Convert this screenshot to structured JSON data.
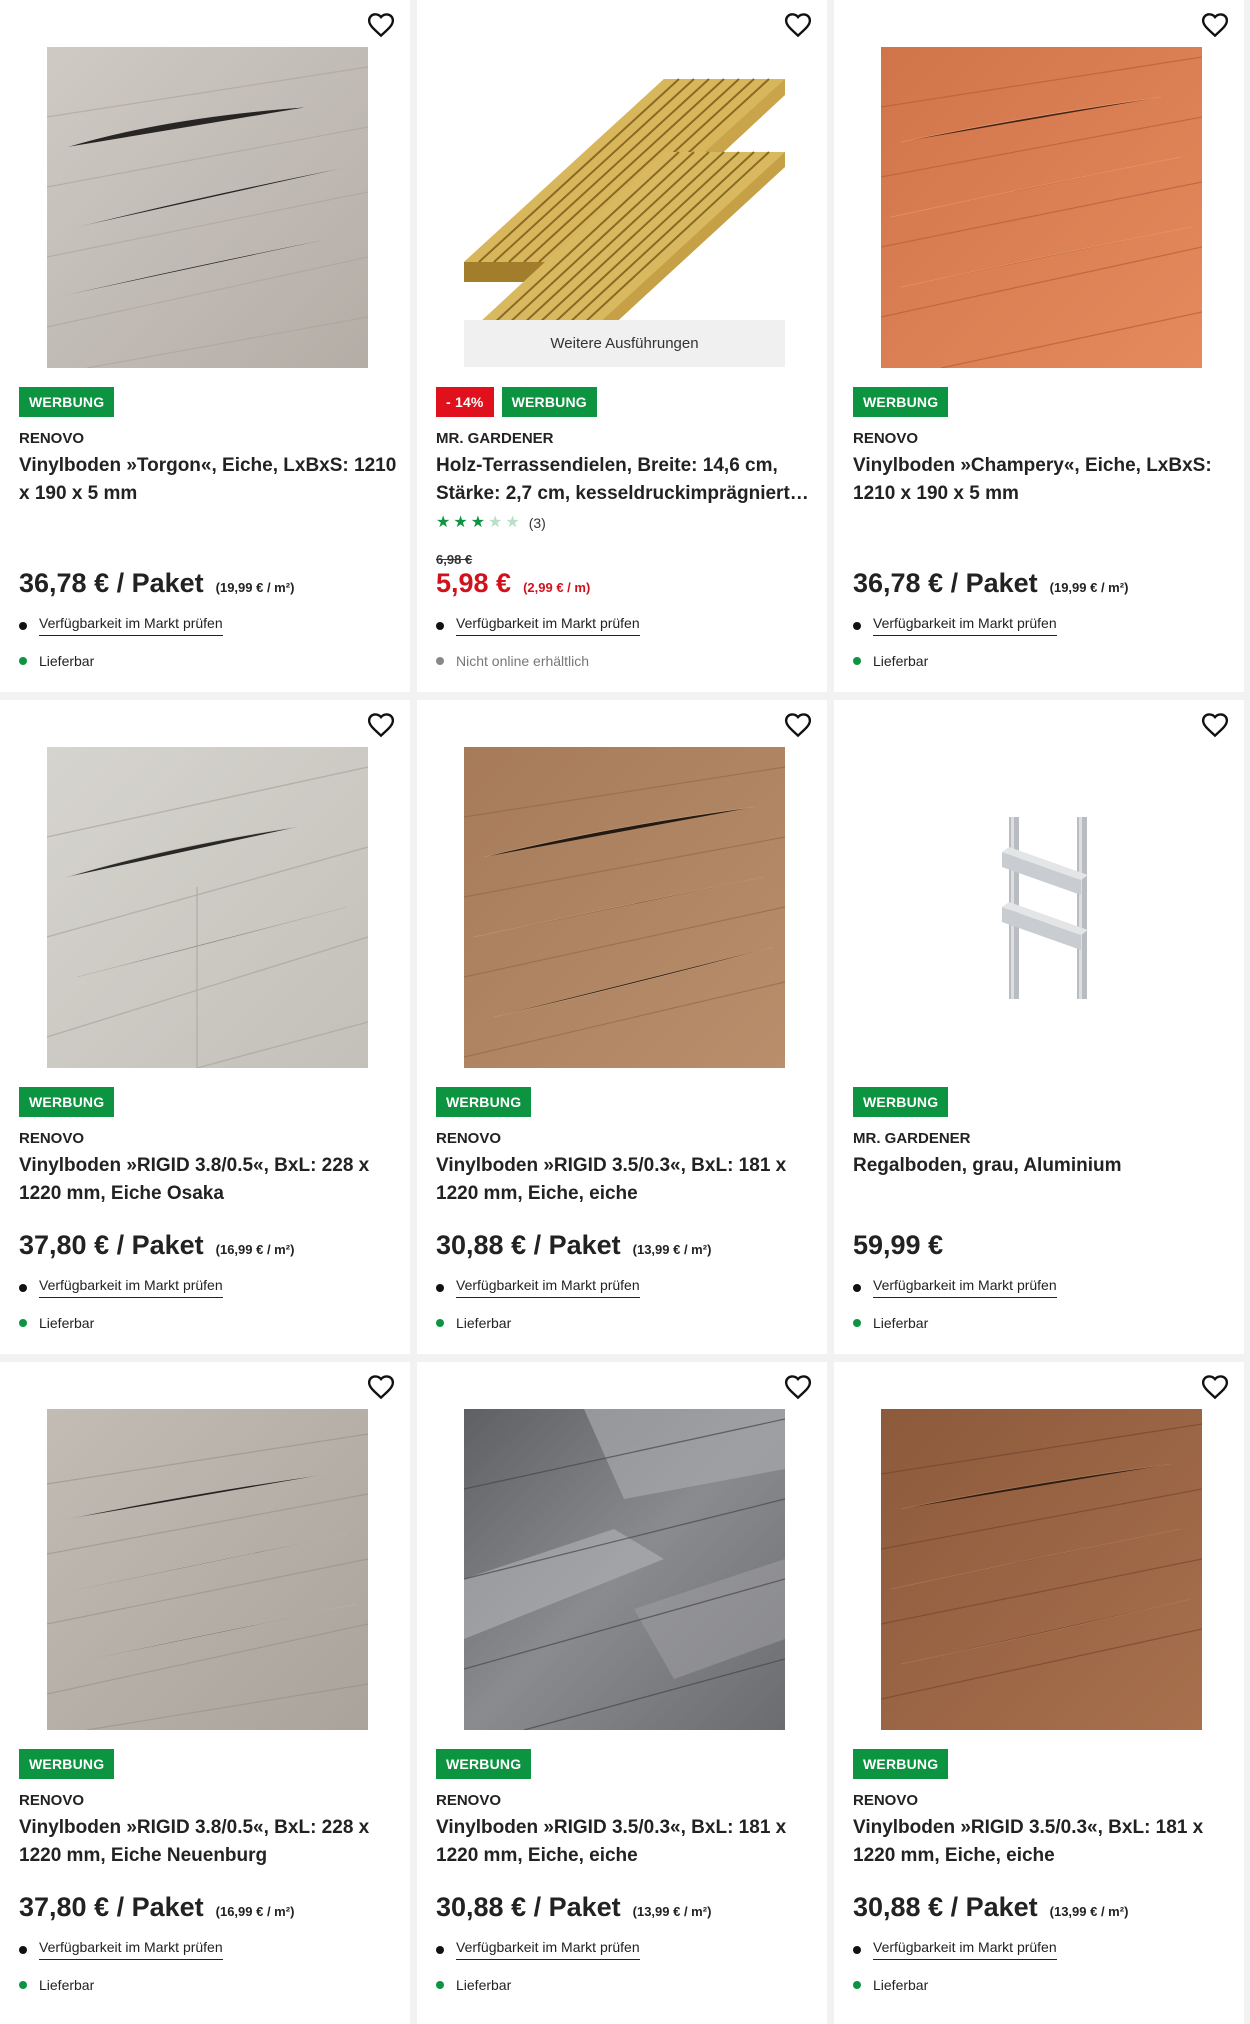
{
  "colors": {
    "ad_badge": "#0d9441",
    "sale_badge": "#e0101c",
    "sale_price": "#d1121c",
    "available_dot": "#0d9441"
  },
  "products": [
    {
      "brand": "RENOVO",
      "title": "Vinylboden »Torgon«, Eiche, LxBxS: 1210 x 190 x 5 mm",
      "badge": "WERBUNG",
      "price": "36,78 € / Paket",
      "unit_price": "(19,99 € / m²)",
      "market_check": "Verfügbarkeit im Markt prüfen",
      "status": "Lieferbar",
      "image": "light-grey-oak-floor",
      "favorite_icon": "heart-outline-icon"
    },
    {
      "brand": "MR. GARDENER",
      "title_line1": "Holz-Terrassendielen, Breite: 14,6 cm,",
      "title_line2": "Stärke: 2,7 cm, kesseldruckimprägniert…",
      "sale_badge": "- 14%",
      "badge": "WERBUNG",
      "more_variants": "Weitere Ausführungen",
      "rating": 3,
      "rating_max": 5,
      "rating_count": "(3)",
      "old_price": "6,98 €",
      "price": "5,98 €",
      "unit_price": "(2,99 € / m)",
      "market_check": "Verfügbarkeit im Markt prüfen",
      "status": "Nicht online erhältlich",
      "image": "wooden-decking-boards",
      "favorite_icon": "heart-outline-icon"
    },
    {
      "brand": "RENOVO",
      "title": "Vinylboden »Champery«, Eiche, LxBxS: 1210 x 190 x 5 mm",
      "badge": "WERBUNG",
      "price": "36,78 € / Paket",
      "unit_price": "(19,99 € / m²)",
      "market_check": "Verfügbarkeit im Markt prüfen",
      "status": "Lieferbar",
      "image": "orange-oak-floor",
      "favorite_icon": "heart-outline-icon"
    },
    {
      "brand": "RENOVO",
      "title": "Vinylboden »RIGID 3.8/0.5«, BxL: 228 x 1220 mm, Eiche Osaka",
      "badge": "WERBUNG",
      "price": "37,80 € / Paket",
      "unit_price": "(16,99 € / m²)",
      "market_check": "Verfügbarkeit im Markt prüfen",
      "status": "Lieferbar",
      "image": "pale-grey-oak-floor",
      "favorite_icon": "heart-outline-icon"
    },
    {
      "brand": "RENOVO",
      "title": "Vinylboden »RIGID 3.5/0.3«, BxL: 181 x 1220 mm, Eiche, eiche",
      "badge": "WERBUNG",
      "price": "30,88 € / Paket",
      "unit_price": "(13,99 € / m²)",
      "market_check": "Verfügbarkeit im Markt prüfen",
      "status": "Lieferbar",
      "image": "brown-oak-floor",
      "favorite_icon": "heart-outline-icon"
    },
    {
      "brand": "MR. GARDENER",
      "title": "Regalboden, grau, Aluminium",
      "badge": "WERBUNG",
      "price": "59,99 €",
      "unit_price": "",
      "market_check": "Verfügbarkeit im Markt prüfen",
      "status": "Lieferbar",
      "image": "aluminium-shelf",
      "favorite_icon": "heart-outline-icon"
    },
    {
      "brand": "RENOVO",
      "title": "Vinylboden »RIGID 3.8/0.5«, BxL: 228 x 1220 mm, Eiche Neuenburg",
      "badge": "WERBUNG",
      "price": "37,80 € / Paket",
      "unit_price": "(16,99 € / m²)",
      "market_check": "Verfügbarkeit im Markt prüfen",
      "status": "Lieferbar",
      "image": "greige-oak-floor",
      "favorite_icon": "heart-outline-icon"
    },
    {
      "brand": "RENOVO",
      "title": "Vinylboden »RIGID 3.5/0.3«, BxL: 181 x 1220 mm, Eiche, eiche",
      "badge": "WERBUNG",
      "price": "30,88 € / Paket",
      "unit_price": "(13,99 € / m²)",
      "market_check": "Verfügbarkeit im Markt prüfen",
      "status": "Lieferbar",
      "image": "dark-grey-oak-floor",
      "favorite_icon": "heart-outline-icon"
    },
    {
      "brand": "RENOVO",
      "title": "Vinylboden »RIGID 3.5/0.3«, BxL: 181 x 1220 mm, Eiche, eiche",
      "badge": "WERBUNG",
      "price": "30,88 € / Paket",
      "unit_price": "(13,99 € / m²)",
      "market_check": "Verfügbarkeit im Markt prüfen",
      "status": "Lieferbar",
      "image": "reddish-brown-oak-floor",
      "favorite_icon": "heart-outline-icon"
    }
  ]
}
